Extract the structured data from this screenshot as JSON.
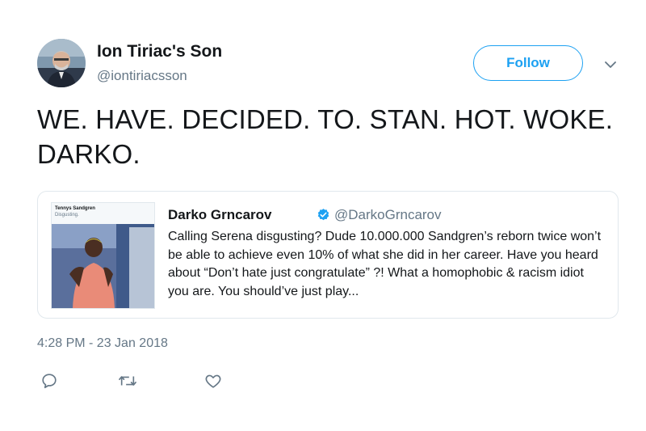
{
  "author": {
    "display_name": "Ion Tiriac's Son",
    "handle": "@iontiriacsson",
    "avatar_icon": "user-avatar"
  },
  "follow_button": {
    "label": "Follow"
  },
  "menu": {
    "icon": "chevron-down-icon"
  },
  "tweet": {
    "text": "WE. HAVE. DECIDED. TO. STAN. HOT. WOKE. DARKO.",
    "timestamp": "4:28 PM - 23 Jan 2018"
  },
  "quoted_tweet": {
    "author_name": "Darko Grncarov",
    "verified": true,
    "handle": "@DarkoGrncarov",
    "text": "Calling Serena disgusting? Dude 10.000.000 Sandgren’s reborn twice won’t be able to achieve even 10% of what she did in her career. Have you heard about “Don’t hate just congratulate” ?! What a homophobic & racism idiot you are. You should’ve just play...",
    "thumbnail": {
      "header_name": "Tennys Sandgren",
      "header_text": "Disgusting."
    }
  },
  "actions": [
    {
      "name": "reply",
      "icon": "reply-icon"
    },
    {
      "name": "retweet",
      "icon": "retweet-icon"
    },
    {
      "name": "like",
      "icon": "heart-icon"
    }
  ],
  "colors": {
    "accent": "#1da1f2",
    "text_primary": "#14171a",
    "text_secondary": "#657786",
    "border": "#e1e8ed",
    "verified_badge": "#1da1f2"
  }
}
